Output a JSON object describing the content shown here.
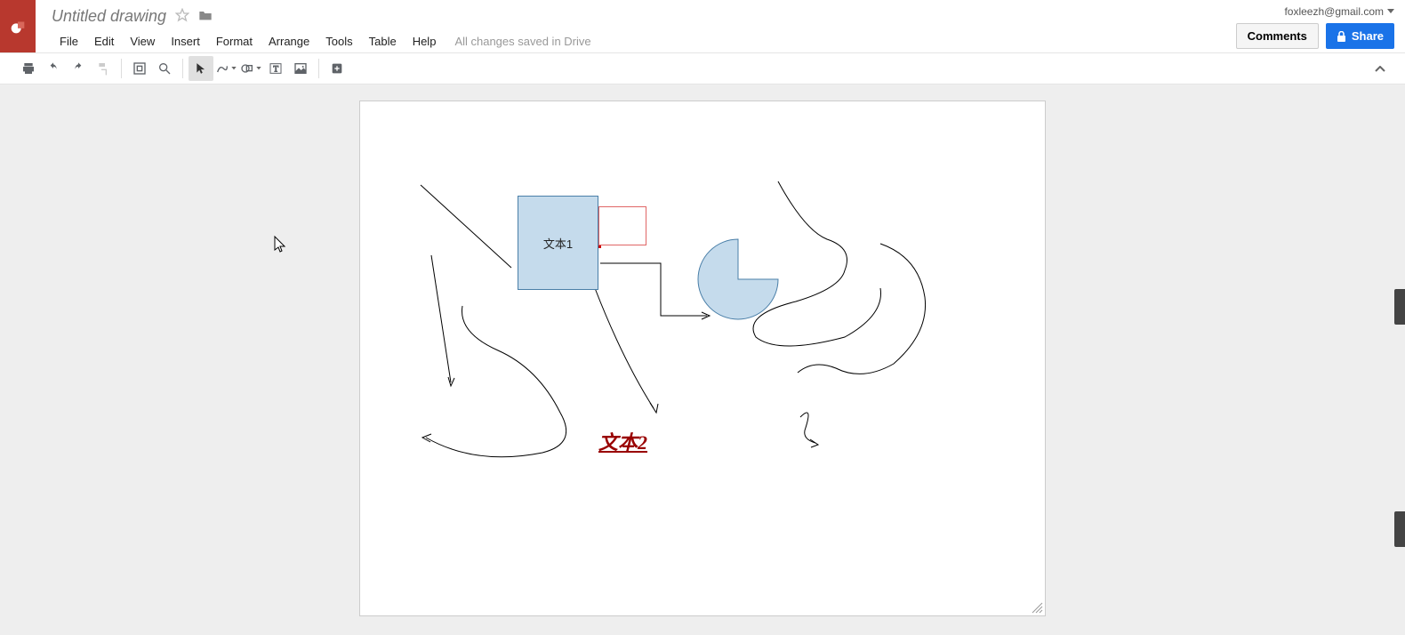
{
  "doc": {
    "title": "Untitled drawing"
  },
  "menu": {
    "file": "File",
    "edit": "Edit",
    "view": "View",
    "insert": "Insert",
    "format": "Format",
    "arrange": "Arrange",
    "tools": "Tools",
    "table": "Table",
    "help": "Help"
  },
  "status": {
    "saved": "All changes saved in Drive"
  },
  "user": {
    "email": "foxleezh@gmail.com"
  },
  "buttons": {
    "comments": "Comments",
    "share": "Share"
  },
  "canvas": {
    "shapes": {
      "text1": "文本1",
      "text2": "文本2"
    }
  }
}
